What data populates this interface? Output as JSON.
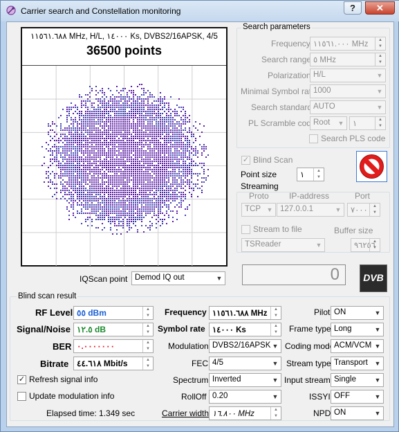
{
  "window": {
    "title": "Carrier search and Constellation monitoring",
    "help_label": "?",
    "close_label": "✕"
  },
  "plot": {
    "info_line": "١١٥٦١.٦٨٨ MHz, H/L, ١٤٠٠٠ Ks, DVBS2/16APSK, 4/5",
    "points_label": "36500 points",
    "dot_color": "#5a1aa6",
    "iq_label": "IQScan point",
    "iq_value": "Demod IQ out"
  },
  "search": {
    "group_title": "Search parameters",
    "frequency_label": "Frequency",
    "frequency_value": "١١٥٦١.٠٠٠ MHz",
    "range_label": "Search range",
    "range_value": "٥ MHz",
    "polarization_label": "Polarization",
    "polarization_value": "H/L",
    "min_sr_label": "Minimal Symbol rate",
    "min_sr_value": "1000",
    "standard_label": "Search standard",
    "standard_value": "AUTO",
    "pl_label": "PL Scramble code",
    "pl_mode": "Root",
    "pl_value": "١",
    "search_pls_label": "Search PLS code",
    "blind_scan_label": "Blind Scan",
    "point_size_label": "Point size",
    "point_size_value": "١"
  },
  "streaming": {
    "group_title": "Streaming",
    "proto_header": "Proto",
    "ip_header": "IP-address",
    "port_header": "Port",
    "proto_value": "TCP",
    "ip_value": "127.0.0.1",
    "port_value": "٧٠٠٠",
    "to_file_label": "Stream to file",
    "buffer_label": "Buffer size",
    "reader_value": "TSReader",
    "buffer_value": "٩٦٢٥٦"
  },
  "counter": {
    "value": "0"
  },
  "logo": {
    "text": "DVB"
  },
  "result": {
    "group_title": "Blind scan result",
    "rf_label": "RF Level",
    "rf_value": "٥٥ dBm",
    "rf_color": "#1a5fd6",
    "sn_label": "Signal/Noise",
    "sn_value": "١٢.٥ dB",
    "sn_color": "#1c8a2e",
    "ber_label": "BER",
    "ber_value": "٠.٠٠٠٠٠٠٠",
    "ber_color": "#e0202a",
    "bitrate_label": "Bitrate",
    "bitrate_value": "٤٤.٦١٨ Mbit/s",
    "freq_label": "Frequency",
    "freq_value": "١١٥٦١.٦٨٨ MHz",
    "sr_label": "Symbol rate",
    "sr_value": "١٤٠٠٠ Ks",
    "modulation_label": "Modulation",
    "modulation_value": "DVBS2/16APSK",
    "fec_label": "FEC",
    "fec_value": "4/5",
    "spectrum_label": "Spectrum",
    "spectrum_value": "Inverted",
    "rolloff_label": "RollOff",
    "rolloff_value": "0.20",
    "width_label": "Carrier width",
    "width_value": "١٦.٨٠٠ MHz",
    "pilot_label": "Pilot",
    "pilot_value": "ON",
    "frame_label": "Frame type",
    "frame_value": "Long",
    "coding_label": "Coding mode",
    "coding_value": "ACM/VCM",
    "stream_label": "Stream type",
    "stream_value": "Transport",
    "input_label": "Input stream",
    "input_value": "Single",
    "issyi_label": "ISSYI",
    "issyi_value": "OFF",
    "npd_label": "NPD",
    "npd_value": "ON",
    "refresh_label": "Refresh signal info",
    "update_label": "Update modulation info",
    "elapsed_label": "Elapsed time: 1.349 sec"
  }
}
